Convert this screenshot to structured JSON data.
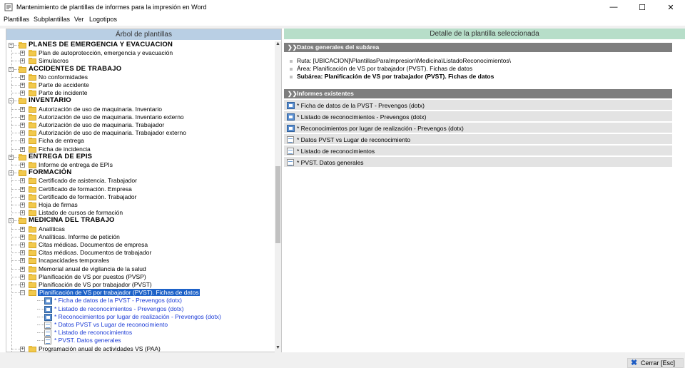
{
  "window": {
    "title": "Mantenimiento de plantillas de informes para la impresión en Word",
    "minimize_glyph": "—",
    "maximize_glyph": "☐",
    "close_glyph": "✕"
  },
  "menu": [
    "Plantillas",
    "Subplantillas",
    "Ver",
    "Logotipos"
  ],
  "left_pane": {
    "header": "Árbol de plantillas",
    "tree": {
      "categories": [
        {
          "label": "PLANES DE EMERGENCIA Y EVACUACIÓN",
          "items": [
            "Plan de autoprotección, emergencia y evacuación",
            "Simulacros"
          ]
        },
        {
          "label": "ACCIDENTES DE TRABAJO",
          "items": [
            "No conformidades",
            "Parte de accidente",
            "Parte de incidente"
          ]
        },
        {
          "label": "INVENTARIO",
          "items": [
            "Autorización de uso de maquinaria. Inventario",
            "Autorización de uso de maquinaria. Inventario externo",
            "Autorización de uso de maquinaria. Trabajador",
            "Autorización de uso de maquinaria. Trabajador externo",
            "Ficha de entrega",
            "Ficha de incidencia"
          ]
        },
        {
          "label": "ENTREGA DE EPIS",
          "items": [
            "Informe de entrega de EPIs"
          ]
        },
        {
          "label": "FORMACIÓN",
          "items": [
            "Certificado de asistencia. Trabajador",
            "Certificado de formación. Empresa",
            "Certificado de formación. Trabajador",
            "Hoja de firmas",
            "Listado de cursos de formación"
          ]
        },
        {
          "label": "MEDICINA DEL TRABAJO",
          "items": [
            "Analíticas",
            "Analíticas. Informe de petición",
            "Citas médicas. Documentos de empresa",
            "Citas médicas. Documentos de trabajador",
            "Incapacidades temporales",
            "Memorial anual de vigilancia de la salud",
            "Planificación de VS por puestos (PVSP)",
            "Planificación de VS por trabajador (PVST)",
            "Planificación de VS por trabajador (PVST). Fichas de datos",
            "Programación anual de actividades VS (PAA)"
          ]
        }
      ],
      "selected_children": [
        {
          "label": "* Ficha de datos de la PVST - Prevengos (dotx)",
          "icon": "excel-template-icon"
        },
        {
          "label": "* Listado de reconocimientos - Prevengos (dotx)",
          "icon": "excel-template-icon"
        },
        {
          "label": "* Reconocimientos por lugar de realización - Prevengos (dotx)",
          "icon": "excel-template-icon"
        },
        {
          "label": "* Datos PVST vs Lugar de reconocimiento",
          "icon": "document-icon"
        },
        {
          "label": "* Listado de reconocimientos",
          "icon": "document-icon"
        },
        {
          "label": "* PVST. Datos generales",
          "icon": "document-icon"
        }
      ]
    }
  },
  "right_pane": {
    "header": "Detalle de la plantilla seleccionada",
    "general_section": {
      "title": "Datos generales del subárea",
      "ruta": "Ruta: [UBICACION]\\PlantillasParaImpresion\\Medicina\\ListadoReconocimientos\\",
      "area": "Área: Planificación de VS por trabajador (PVST). Fichas de datos",
      "subarea": "Subárea: Planificación de VS por trabajador (PVST). Fichas de datos"
    },
    "reports_section": {
      "title": "Informes existentes",
      "reports": [
        {
          "label": "* Ficha de datos de la PVST - Prevengos (dotx)",
          "icon": "excel-template-icon"
        },
        {
          "label": "* Listado de reconocimientos - Prevengos (dotx)",
          "icon": "excel-template-icon"
        },
        {
          "label": "* Reconocimientos por lugar de realización - Prevengos (dotx)",
          "icon": "excel-template-icon"
        },
        {
          "label": "* Datos PVST vs Lugar de reconocimiento",
          "icon": "document-icon"
        },
        {
          "label": "* Listado de reconocimientos",
          "icon": "document-icon"
        },
        {
          "label": "* PVST. Datos generales",
          "icon": "document-icon"
        }
      ]
    }
  },
  "footer": {
    "close_button": "Cerrar  [Esc]"
  },
  "colors": {
    "left_header_bg": "#b9cfe4",
    "right_header_bg": "#b7dec9",
    "section_bar_bg": "#7e7e7e",
    "selection_bg": "#1e62c8",
    "child_link_color": "#1a3ad6"
  }
}
